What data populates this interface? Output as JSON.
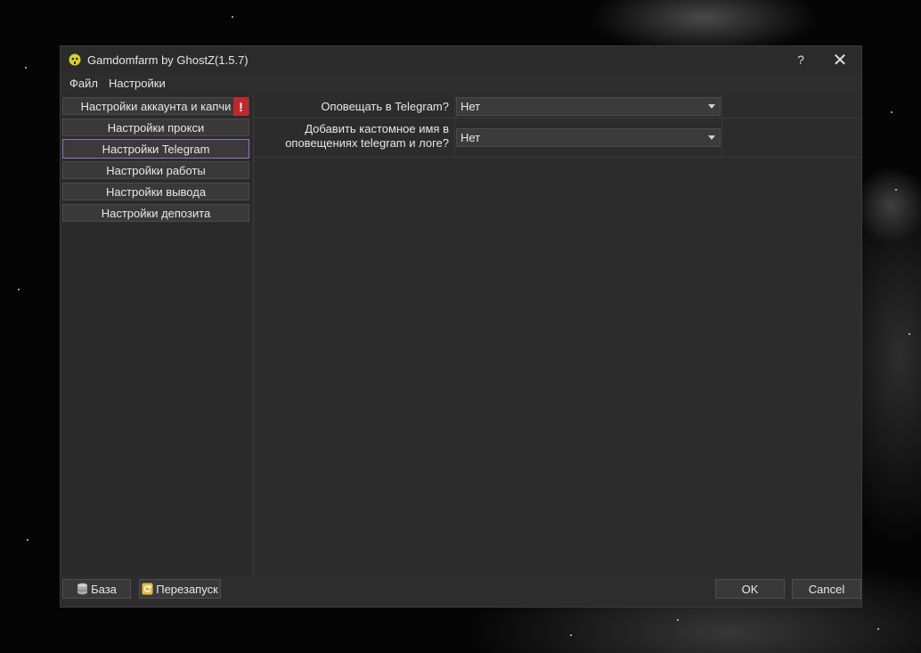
{
  "window": {
    "title": "Gamdomfarm by GhostZ(1.5.7)",
    "help_label": "?",
    "close_label": "✕"
  },
  "menu": [
    "Файл",
    "Настройки"
  ],
  "sidebar": {
    "items": [
      {
        "label": "Настройки аккаунта и капчи",
        "alert": "!"
      },
      {
        "label": "Настройки прокси"
      },
      {
        "label": "Настройки Telegram",
        "active": true
      },
      {
        "label": "Настройки работы"
      },
      {
        "label": "Настройки вывода"
      },
      {
        "label": "Настройки депозита"
      }
    ]
  },
  "settings": [
    {
      "label": "Оповещать в Telegram?",
      "value": "Нет"
    },
    {
      "label_line1": "Добавить кастомное имя в",
      "label_line2": "оповещениях telegram и логе?",
      "value": "Нет"
    }
  ],
  "footer": {
    "base_label": "База",
    "restart_label": "Перезапуск",
    "ok_label": "OK",
    "cancel_label": "Cancel"
  },
  "colors": {
    "accent": "#9b6fd0",
    "alert": "#c0282d",
    "app_icon": "#d8d22a"
  }
}
